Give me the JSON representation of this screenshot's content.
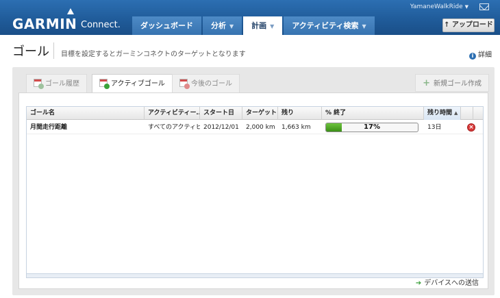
{
  "header": {
    "logo_text": "GARMIN",
    "logo_sub": "Connect.",
    "user_name": "YamaneWalkRide",
    "nav_tabs": [
      {
        "label": "ダッシュボード",
        "caret": false,
        "active": false
      },
      {
        "label": "分析",
        "caret": true,
        "active": false
      },
      {
        "label": "計画",
        "caret": true,
        "active": true
      },
      {
        "label": "アクティビティ検索",
        "caret": true,
        "active": false
      }
    ],
    "upload_label": "↑ アップロード"
  },
  "page": {
    "title": "ゴール",
    "description": "目標を設定するとガーミンコネクトのターゲットとなります",
    "detail_label": "詳細"
  },
  "tabs": {
    "history": "ゴール履歴",
    "active": "アクティブゴール",
    "future": "今後のゴール",
    "new_goal": "新規ゴール作成"
  },
  "table": {
    "columns": [
      "ゴール名",
      "アクティビティー…",
      "スタート日",
      "ターゲット",
      "残り",
      "% 終了",
      "残り時間"
    ],
    "rows": [
      {
        "name": "月間走行距離",
        "activity": "すべてのアクティビ…",
        "start": "2012/12/01",
        "target": "2,000 km",
        "remaining": "1,663 km",
        "percent": 17,
        "percent_label": "17%",
        "time_left": "13日"
      }
    ]
  },
  "footer": {
    "send_to_device": "デバイスへの送信"
  },
  "colors": {
    "header_blue": "#1f5a98",
    "progress_green": "#3b8f17",
    "delete_red": "#d83a3a"
  }
}
